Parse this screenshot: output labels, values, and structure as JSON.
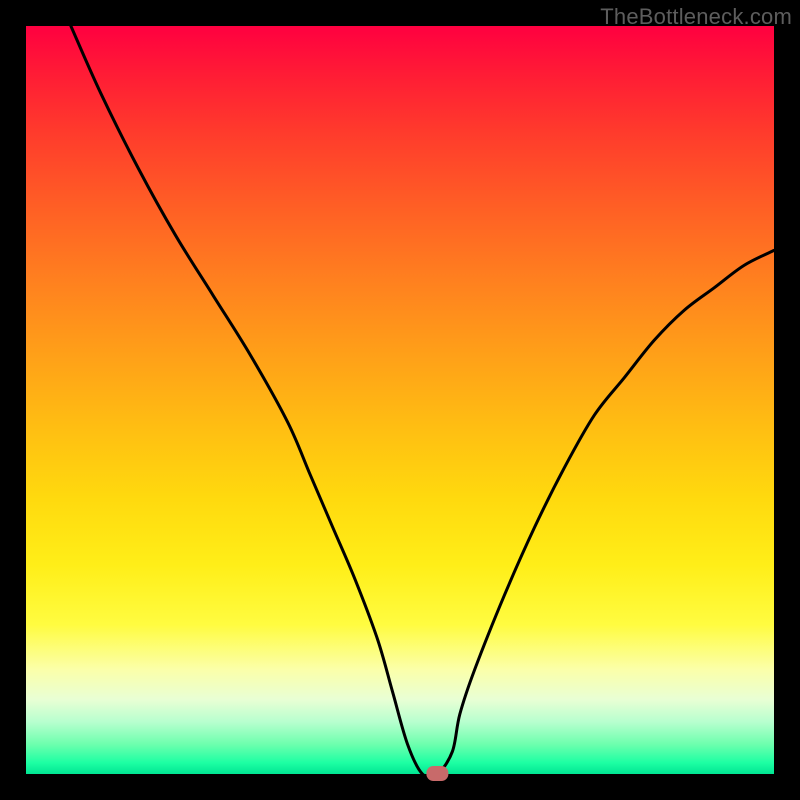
{
  "watermark": "TheBottleneck.com",
  "chart_data": {
    "type": "line",
    "title": "",
    "xlabel": "",
    "ylabel": "",
    "x_range": [
      0,
      100
    ],
    "y_range": [
      0,
      100
    ],
    "grid": false,
    "legend": false,
    "series": [
      {
        "name": "curve",
        "x": [
          6,
          10,
          15,
          20,
          25,
          30,
          35,
          38,
          41,
          44,
          47,
          49,
          51,
          53,
          55,
          57,
          58,
          60,
          64,
          68,
          72,
          76,
          80,
          84,
          88,
          92,
          96,
          100
        ],
        "y": [
          100,
          91,
          81,
          72,
          64,
          56,
          47,
          40,
          33,
          26,
          18,
          11,
          4,
          0,
          0,
          3,
          8,
          14,
          24,
          33,
          41,
          48,
          53,
          58,
          62,
          65,
          68,
          70
        ]
      }
    ],
    "marker": {
      "x": 55,
      "y": 0,
      "color": "#c86a6a"
    },
    "background_gradient": {
      "top": "#ff0040",
      "mid": "#ffdf10",
      "bottom": "#00e593"
    },
    "border_color": "#000000"
  }
}
